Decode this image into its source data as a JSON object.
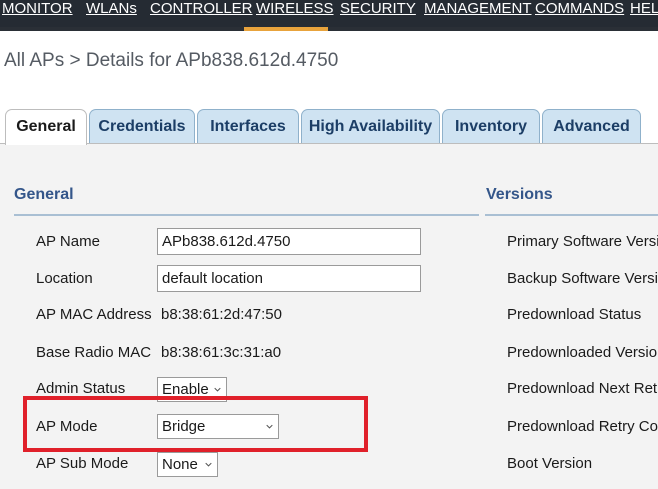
{
  "nav": {
    "items": [
      "MONITOR",
      "WLANs",
      "CONTROLLER",
      "WIRELESS",
      "SECURITY",
      "MANAGEMENT",
      "COMMANDS",
      "HEL"
    ],
    "active": "WIRELESS"
  },
  "page_title": "All APs > Details for APb838.612d.4750",
  "tabs": [
    "General",
    "Credentials",
    "Interfaces",
    "High Availability",
    "Inventory",
    "Advanced"
  ],
  "active_tab": "General",
  "general": {
    "heading": "General",
    "fields": {
      "ap_name": {
        "label": "AP Name",
        "value": "APb838.612d.4750"
      },
      "location": {
        "label": "Location",
        "value": "default location"
      },
      "ap_mac": {
        "label": "AP MAC Address",
        "value": "b8:38:61:2d:47:50"
      },
      "base_radio_mac": {
        "label": "Base Radio MAC",
        "value": "b8:38:61:3c:31:a0"
      },
      "admin_status": {
        "label": "Admin Status",
        "value": "Enable"
      },
      "ap_mode": {
        "label": "AP Mode",
        "value": "Bridge"
      },
      "ap_sub_mode": {
        "label": "AP Sub Mode",
        "value": "None"
      }
    }
  },
  "versions": {
    "heading": "Versions",
    "rows": [
      "Primary Software Version",
      "Backup Software Version",
      "Predownload Status",
      "Predownloaded Version",
      "Predownload Next Retry T",
      "Predownload Retry Count",
      "Boot Version"
    ]
  },
  "colors": {
    "nav_bg": "#252b33",
    "nav_active_accent": "#e8a33c",
    "tab_bg": "#cfe3f2",
    "section_heading": "#34568a",
    "highlight": "#e0202a"
  }
}
